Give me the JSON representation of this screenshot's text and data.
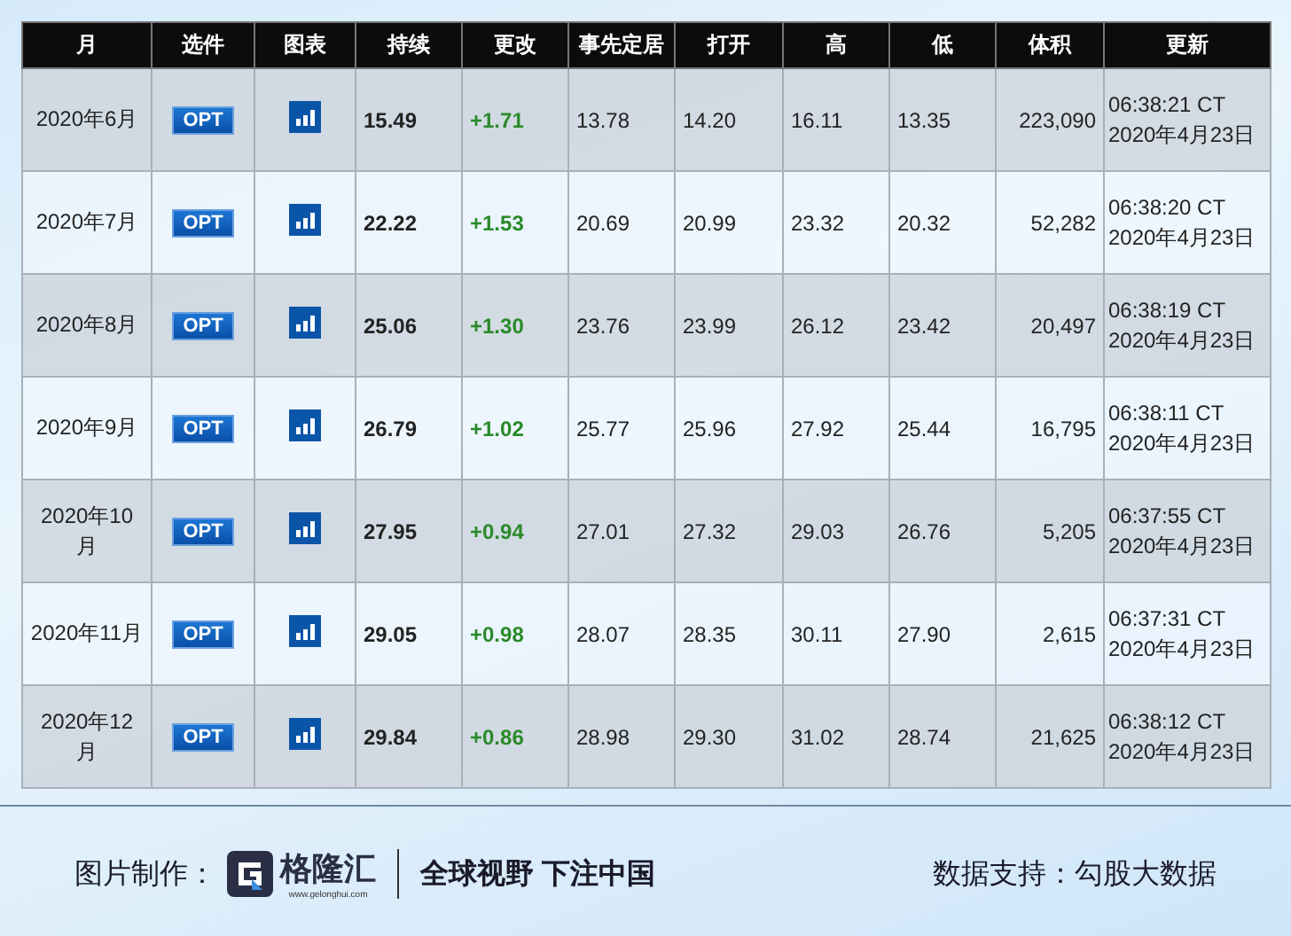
{
  "table": {
    "columns": [
      "月",
      "选件",
      "图表",
      "持续",
      "更改",
      "事先定居",
      "打开",
      "高",
      "低",
      "体积",
      "更新"
    ],
    "rows": [
      {
        "month": "2020年6月",
        "option": "OPT",
        "last": "15.49",
        "change": "+1.71",
        "prior_settle": "13.78",
        "open": "14.20",
        "high": "16.11",
        "low": "13.35",
        "volume": "223,090",
        "updated": "06:38:21 CT 2020年4月23日"
      },
      {
        "month": "2020年7月",
        "option": "OPT",
        "last": "22.22",
        "change": "+1.53",
        "prior_settle": "20.69",
        "open": "20.99",
        "high": "23.32",
        "low": "20.32",
        "volume": "52,282",
        "updated": "06:38:20 CT 2020年4月23日"
      },
      {
        "month": "2020年8月",
        "option": "OPT",
        "last": "25.06",
        "change": "+1.30",
        "prior_settle": "23.76",
        "open": "23.99",
        "high": "26.12",
        "low": "23.42",
        "volume": "20,497",
        "updated": "06:38:19 CT 2020年4月23日"
      },
      {
        "month": "2020年9月",
        "option": "OPT",
        "last": "26.79",
        "change": "+1.02",
        "prior_settle": "25.77",
        "open": "25.96",
        "high": "27.92",
        "low": "25.44",
        "volume": "16,795",
        "updated": "06:38:11 CT 2020年4月23日"
      },
      {
        "month": "2020年10月",
        "option": "OPT",
        "last": "27.95",
        "change": "+0.94",
        "prior_settle": "27.01",
        "open": "27.32",
        "high": "29.03",
        "low": "26.76",
        "volume": "5,205",
        "updated": "06:37:55 CT 2020年4月23日"
      },
      {
        "month": "2020年11月",
        "option": "OPT",
        "last": "29.05",
        "change": "+0.98",
        "prior_settle": "28.07",
        "open": "28.35",
        "high": "30.11",
        "low": "27.90",
        "volume": "2,615",
        "updated": "06:37:31 CT 2020年4月23日"
      },
      {
        "month": "2020年12月",
        "option": "OPT",
        "last": "29.84",
        "change": "+0.86",
        "prior_settle": "28.98",
        "open": "29.30",
        "high": "31.02",
        "low": "28.74",
        "volume": "21,625",
        "updated": "06:38:12 CT 2020年4月23日"
      }
    ]
  },
  "footer": {
    "made_by_label": "图片制作：",
    "logo_name": "格隆汇",
    "logo_url": "www.gelonghui.com",
    "slogan": "全球视野 下注中国",
    "data_label": "数据支持：勾股大数据"
  }
}
